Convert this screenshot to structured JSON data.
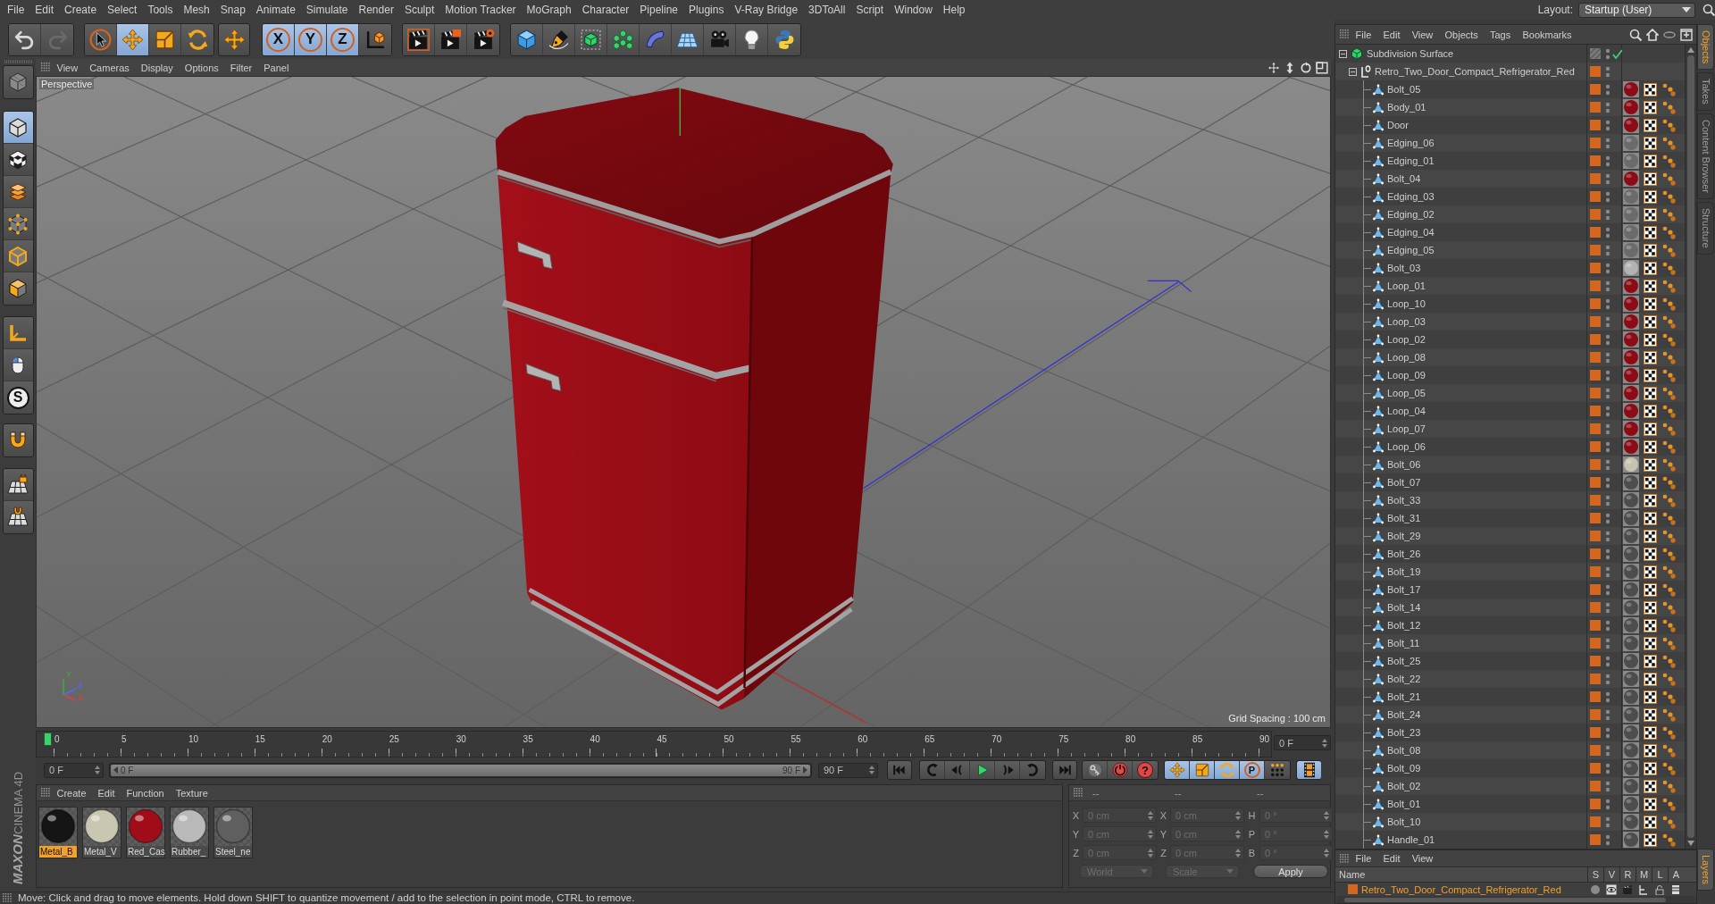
{
  "menu_bar": {
    "items": [
      "File",
      "Edit",
      "Create",
      "Select",
      "Tools",
      "Mesh",
      "Snap",
      "Animate",
      "Simulate",
      "Render",
      "Sculpt",
      "Motion Tracker",
      "MoGraph",
      "Character",
      "Pipeline",
      "Plugins",
      "V-Ray Bridge",
      "3DToAll",
      "Script",
      "Window",
      "Help"
    ],
    "layout_label": "Layout:",
    "layout_value": "Startup (User)"
  },
  "toolbar": {
    "history": [
      {
        "disabled": false
      },
      {
        "disabled": true
      }
    ],
    "tools": [
      {
        "active": false
      },
      {
        "active": true
      },
      {
        "active": false
      },
      {
        "active": false
      }
    ],
    "recent_tool": {
      "active": false
    },
    "axis_locks": [
      {
        "label": "X",
        "active": true
      },
      {
        "label": "Y",
        "active": true
      },
      {
        "label": "Z",
        "active": true
      }
    ],
    "coordinate_system": {
      "active": false
    }
  },
  "left_toolbar": [
    {
      "active": false
    },
    {
      "active": true
    },
    {
      "active": false
    },
    {
      "active": false
    },
    {
      "active": false
    },
    {
      "active": false
    },
    {
      "active": false
    },
    {
      "active": false
    },
    {
      "active": false
    },
    {
      "label": "S",
      "active": false
    },
    {
      "active": false
    },
    {
      "active": false
    },
    {
      "active": false
    }
  ],
  "viewport": {
    "menu": [
      "View",
      "Cameras",
      "Display",
      "Options",
      "Filter",
      "Panel"
    ],
    "camera": "Perspective",
    "grid_spacing": "Grid Spacing : 100 cm",
    "axis_labels": [
      "Y",
      "Z",
      "X"
    ]
  },
  "timeline": {
    "ticks": [
      "0",
      "5",
      "10",
      "15",
      "20",
      "25",
      "30",
      "35",
      "40",
      "45",
      "50",
      "55",
      "60",
      "65",
      "70",
      "75",
      "80",
      "85",
      "90"
    ],
    "level": 0,
    "current_frame": "0 F"
  },
  "transport": {
    "start_field": "0 F",
    "range_slider": {
      "start": "0 F",
      "end": "90 F",
      "level": 1
    },
    "end_field": "90 F",
    "help_label": "?",
    "key_tracks": [
      {
        "active": true
      },
      {
        "active": true
      },
      {
        "active": true
      },
      {
        "label": "P",
        "active": true
      },
      {
        "active": false
      }
    ],
    "film_strip": {
      "active": true
    }
  },
  "materials": {
    "menu": [
      "Create",
      "Edit",
      "Function",
      "Texture"
    ],
    "items": [
      {
        "name": "Metal_B",
        "selected": true,
        "color": "#151515"
      },
      {
        "name": "Metal_V",
        "selected": false,
        "color": "#c9c7b2"
      },
      {
        "name": "Red_Cas",
        "selected": false,
        "color": "#a00d18"
      },
      {
        "name": "Rubber_",
        "selected": false,
        "color": "#b9b9b9"
      },
      {
        "name": "Steel_ne",
        "selected": false,
        "color": "#5f5f5f"
      }
    ]
  },
  "coordinates": {
    "headers": [
      "--",
      "--",
      "--"
    ],
    "rows": [
      {
        "fields": [
          {
            "label": "X",
            "value": "0 cm"
          },
          {
            "label": "X",
            "value": "0 cm"
          },
          {
            "label": "H",
            "value": "0 °"
          }
        ]
      },
      {
        "fields": [
          {
            "label": "Y",
            "value": "0 cm"
          },
          {
            "label": "Y",
            "value": "0 cm"
          },
          {
            "label": "P",
            "value": "0 °"
          }
        ]
      },
      {
        "fields": [
          {
            "label": "Z",
            "value": "0 cm"
          },
          {
            "label": "Z",
            "value": "0 cm"
          },
          {
            "label": "B",
            "value": "0 °"
          }
        ]
      }
    ],
    "dropdowns": [
      "World",
      "Scale"
    ],
    "apply": "Apply"
  },
  "objects": {
    "menu": [
      "File",
      "Edit",
      "View",
      "Objects",
      "Tags",
      "Bookmarks"
    ],
    "tree": [
      {
        "name": "Subdivision Surface",
        "kind": "subdivision",
        "expanded": true,
        "in_layer": false,
        "enabled": true,
        "children": [
          {
            "name": "Retro_Two_Door_Compact_Refrigerator_Red",
            "kind": "null",
            "expanded": true,
            "in_layer": true,
            "children": [
              {
                "name": "Bolt_05",
                "kind": "polygon",
                "in_layer": true,
                "color": "#8c0c15"
              },
              {
                "name": "Body_01",
                "kind": "polygon",
                "in_layer": true,
                "color": "#8c0c15"
              },
              {
                "name": "Door",
                "kind": "polygon",
                "in_layer": true,
                "color": "#8c0c15"
              },
              {
                "name": "Edging_06",
                "kind": "polygon",
                "in_layer": true,
                "color": "#6b6b6b"
              },
              {
                "name": "Edging_01",
                "kind": "polygon",
                "in_layer": true,
                "color": "#6b6b6b"
              },
              {
                "name": "Bolt_04",
                "kind": "polygon",
                "in_layer": true,
                "color": "#8c0c15"
              },
              {
                "name": "Edging_03",
                "kind": "polygon",
                "in_layer": true,
                "color": "#6b6b6b"
              },
              {
                "name": "Edging_02",
                "kind": "polygon",
                "in_layer": true,
                "color": "#6b6b6b"
              },
              {
                "name": "Edging_04",
                "kind": "polygon",
                "in_layer": true,
                "color": "#6b6b6b"
              },
              {
                "name": "Edging_05",
                "kind": "polygon",
                "in_layer": true,
                "color": "#6b6b6b"
              },
              {
                "name": "Bolt_03",
                "kind": "polygon",
                "in_layer": true,
                "color": "#b3b3b3"
              },
              {
                "name": "Loop_01",
                "kind": "polygon",
                "in_layer": true,
                "color": "#8c0c15"
              },
              {
                "name": "Loop_10",
                "kind": "polygon",
                "in_layer": true,
                "color": "#8c0c15"
              },
              {
                "name": "Loop_03",
                "kind": "polygon",
                "in_layer": true,
                "color": "#8c0c15"
              },
              {
                "name": "Loop_02",
                "kind": "polygon",
                "in_layer": true,
                "color": "#8c0c15"
              },
              {
                "name": "Loop_08",
                "kind": "polygon",
                "in_layer": true,
                "color": "#8c0c15"
              },
              {
                "name": "Loop_09",
                "kind": "polygon",
                "in_layer": true,
                "color": "#8c0c15"
              },
              {
                "name": "Loop_05",
                "kind": "polygon",
                "in_layer": true,
                "color": "#8c0c15"
              },
              {
                "name": "Loop_04",
                "kind": "polygon",
                "in_layer": true,
                "color": "#8c0c15"
              },
              {
                "name": "Loop_07",
                "kind": "polygon",
                "in_layer": true,
                "color": "#8c0c15"
              },
              {
                "name": "Loop_06",
                "kind": "polygon",
                "in_layer": true,
                "color": "#8c0c15"
              },
              {
                "name": "Bolt_06",
                "kind": "polygon",
                "in_layer": true,
                "color": "#c6c4b0"
              },
              {
                "name": "Bolt_07",
                "kind": "polygon",
                "in_layer": true,
                "color": "#4d4d4d"
              },
              {
                "name": "Bolt_33",
                "kind": "polygon",
                "in_layer": true,
                "color": "#4d4d4d"
              },
              {
                "name": "Bolt_31",
                "kind": "polygon",
                "in_layer": true,
                "color": "#4d4d4d"
              },
              {
                "name": "Bolt_29",
                "kind": "polygon",
                "in_layer": true,
                "color": "#4d4d4d"
              },
              {
                "name": "Bolt_26",
                "kind": "polygon",
                "in_layer": true,
                "color": "#4d4d4d"
              },
              {
                "name": "Bolt_19",
                "kind": "polygon",
                "in_layer": true,
                "color": "#4d4d4d"
              },
              {
                "name": "Bolt_17",
                "kind": "polygon",
                "in_layer": true,
                "color": "#4d4d4d"
              },
              {
                "name": "Bolt_14",
                "kind": "polygon",
                "in_layer": true,
                "color": "#4d4d4d"
              },
              {
                "name": "Bolt_12",
                "kind": "polygon",
                "in_layer": true,
                "color": "#4d4d4d"
              },
              {
                "name": "Bolt_11",
                "kind": "polygon",
                "in_layer": true,
                "color": "#4d4d4d"
              },
              {
                "name": "Bolt_25",
                "kind": "polygon",
                "in_layer": true,
                "color": "#4d4d4d"
              },
              {
                "name": "Bolt_22",
                "kind": "polygon",
                "in_layer": true,
                "color": "#4d4d4d"
              },
              {
                "name": "Bolt_21",
                "kind": "polygon",
                "in_layer": true,
                "color": "#4d4d4d"
              },
              {
                "name": "Bolt_24",
                "kind": "polygon",
                "in_layer": true,
                "color": "#4d4d4d"
              },
              {
                "name": "Bolt_23",
                "kind": "polygon",
                "in_layer": true,
                "color": "#4d4d4d"
              },
              {
                "name": "Bolt_08",
                "kind": "polygon",
                "in_layer": true,
                "color": "#4d4d4d"
              },
              {
                "name": "Bolt_09",
                "kind": "polygon",
                "in_layer": true,
                "color": "#4d4d4d"
              },
              {
                "name": "Bolt_02",
                "kind": "polygon",
                "in_layer": true,
                "color": "#4d4d4d"
              },
              {
                "name": "Bolt_01",
                "kind": "polygon",
                "in_layer": true,
                "color": "#4d4d4d"
              },
              {
                "name": "Bolt_10",
                "kind": "polygon",
                "in_layer": true,
                "color": "#4d4d4d"
              },
              {
                "name": "Handle_01",
                "kind": "polygon",
                "in_layer": true,
                "color": "#4d4d4d"
              }
            ]
          }
        ]
      }
    ]
  },
  "layers": {
    "menu": [
      "File",
      "Edit",
      "View"
    ],
    "columns": [
      "Name",
      "S",
      "V",
      "R",
      "M",
      "L",
      "A"
    ],
    "rows": [
      {
        "name": "Retro_Two_Door_Compact_Refrigerator_Red",
        "color": "#d4671f"
      }
    ]
  },
  "side_tabs": {
    "top": [
      {
        "label": "Objects",
        "selected": true
      },
      {
        "label": "Takes",
        "selected": false
      },
      {
        "label": "Content Browser",
        "selected": false
      },
      {
        "label": "Structure",
        "selected": false
      }
    ],
    "bottom": [
      {
        "label": "Layers",
        "selected": true
      }
    ]
  },
  "logo": {
    "brand": "MAXON",
    "product": "CINEMA 4D"
  },
  "status_bar": "Move: Click and drag to move elements. Hold down SHIFT to quantize movement / add to the selection in point mode, CTRL to remove."
}
